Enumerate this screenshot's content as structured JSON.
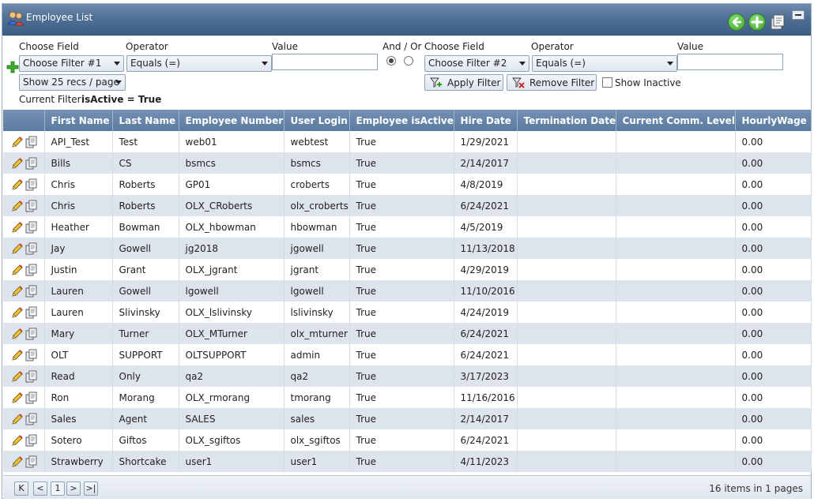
{
  "window": {
    "title": "Employee List"
  },
  "filter": {
    "left": {
      "choose_field_label": "Choose Field",
      "operator_label": "Operator",
      "value_label": "Value",
      "field_value": "Choose Filter #1",
      "operator_value": "Equals (=)",
      "value": ""
    },
    "and_or_label": "And / Or",
    "right": {
      "choose_field_label": "Choose Field",
      "operator_label": "Operator",
      "value_label": "Value",
      "field_value": "Choose Filter #2",
      "operator_value": "Equals (=)",
      "value": ""
    },
    "page_size": "Show 25 recs / page",
    "apply_label": "Apply Filter",
    "remove_label": "Remove Filter",
    "show_inactive_label": "Show Inactive",
    "current_filter_label": "Current Filter:",
    "current_filter_value": "isActive = True"
  },
  "grid": {
    "columns": [
      "",
      "First Name",
      "Last Name",
      "Employee Number",
      "User Login",
      "Employee isActive",
      "Hire Date",
      "Termination Date",
      "Current Comm. Level",
      "HourlyWage"
    ],
    "rows": [
      [
        "API_Test",
        "Test",
        "web01",
        "webtest",
        "True",
        "1/29/2021",
        "",
        "",
        "0.00"
      ],
      [
        "Bills",
        "CS",
        "bsmcs",
        "bsmcs",
        "True",
        "2/14/2017",
        "",
        "",
        "0.00"
      ],
      [
        "Chris",
        "Roberts",
        "GP01",
        "croberts",
        "True",
        "4/8/2019",
        "",
        "",
        "0.00"
      ],
      [
        "Chris",
        "Roberts",
        "OLX_CRoberts",
        "olx_croberts",
        "True",
        "6/24/2021",
        "",
        "",
        "0.00"
      ],
      [
        "Heather",
        "Bowman",
        "OLX_hbowman",
        "hbowman",
        "True",
        "4/5/2019",
        "",
        "",
        "0.00"
      ],
      [
        "Jay",
        "Gowell",
        "jg2018",
        "jgowell",
        "True",
        "11/13/2018",
        "",
        "",
        "0.00"
      ],
      [
        "Justin",
        "Grant",
        "OLX_jgrant",
        "jgrant",
        "True",
        "4/29/2019",
        "",
        "",
        "0.00"
      ],
      [
        "Lauren",
        "Gowell",
        "lgowell",
        "lgowell",
        "True",
        "11/10/2016",
        "",
        "",
        "0.00"
      ],
      [
        "Lauren",
        "Slivinsky",
        "OLX_lslivinsky",
        "lslivinsky",
        "True",
        "4/24/2019",
        "",
        "",
        "0.00"
      ],
      [
        "Mary",
        "Turner",
        "OLX_MTurner",
        "olx_mturner",
        "True",
        "6/24/2021",
        "",
        "",
        "0.00"
      ],
      [
        "OLT",
        "SUPPORT",
        "OLTSUPPORT",
        "admin",
        "True",
        "6/24/2021",
        "",
        "",
        "0.00"
      ],
      [
        "Read",
        "Only",
        "qa2",
        "qa2",
        "True",
        "3/17/2023",
        "",
        "",
        "0.00"
      ],
      [
        "Ron",
        "Morang",
        "OLX_rmorang",
        "tmorang",
        "True",
        "11/16/2016",
        "",
        "",
        "0.00"
      ],
      [
        "Sales",
        "Agent",
        "SALES",
        "sales",
        "True",
        "2/14/2017",
        "",
        "",
        "0.00"
      ],
      [
        "Sotero",
        "Giftos",
        "OLX_sgiftos",
        "olx_sgiftos",
        "True",
        "6/24/2021",
        "",
        "",
        "0.00"
      ],
      [
        "Strawberry",
        "Shortcake",
        "user1",
        "user1",
        "True",
        "4/11/2023",
        "",
        "",
        "0.00"
      ]
    ]
  },
  "pager": {
    "first": "K",
    "prev": "<",
    "current_page": "1",
    "next": ">",
    "last": ">|",
    "items_count": "16",
    "items_text": "items in",
    "pages_count": "1",
    "pages_text": "pages"
  }
}
